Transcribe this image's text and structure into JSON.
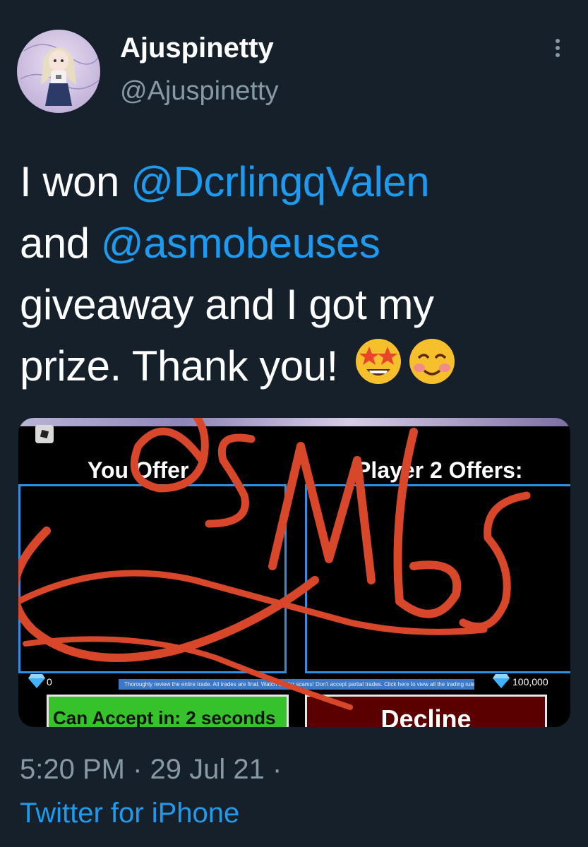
{
  "author": {
    "display_name": "Ajuspinetty",
    "handle": "@Ajuspinetty"
  },
  "tweet": {
    "line1_prefix": "I won ",
    "mention1": "@DcrlingqValen",
    "line2_prefix": "and ",
    "mention2": "@asmobeuses",
    "line3": "giveaway and I got my",
    "line4": "prize. Thank you!",
    "emojis": [
      "star-struck-emoji",
      "smiling-blush-emoji"
    ]
  },
  "media": {
    "left_title": "You Offer",
    "right_title": "Player 2 Offers:",
    "left_value": "0",
    "right_value": "100,000",
    "notice": "Thoroughly review the entire trade. All trades are final. Watch out for scams! Don't accept partial trades. Click here to view all the trading rules",
    "accept_label": "Can Accept in: 2 seconds",
    "decline_label": "Decline",
    "watermark_text": "asmbs"
  },
  "meta": {
    "timestamp": "5:20 PM · 29 Jul 21 ·",
    "source": "Twitter for iPhone"
  },
  "colors": {
    "background": "#15202b",
    "mention": "#1d9bf0",
    "secondary_text": "#8899a6",
    "watermark": "#d9472b",
    "accept": "#35c22a",
    "decline": "#5a0000"
  }
}
